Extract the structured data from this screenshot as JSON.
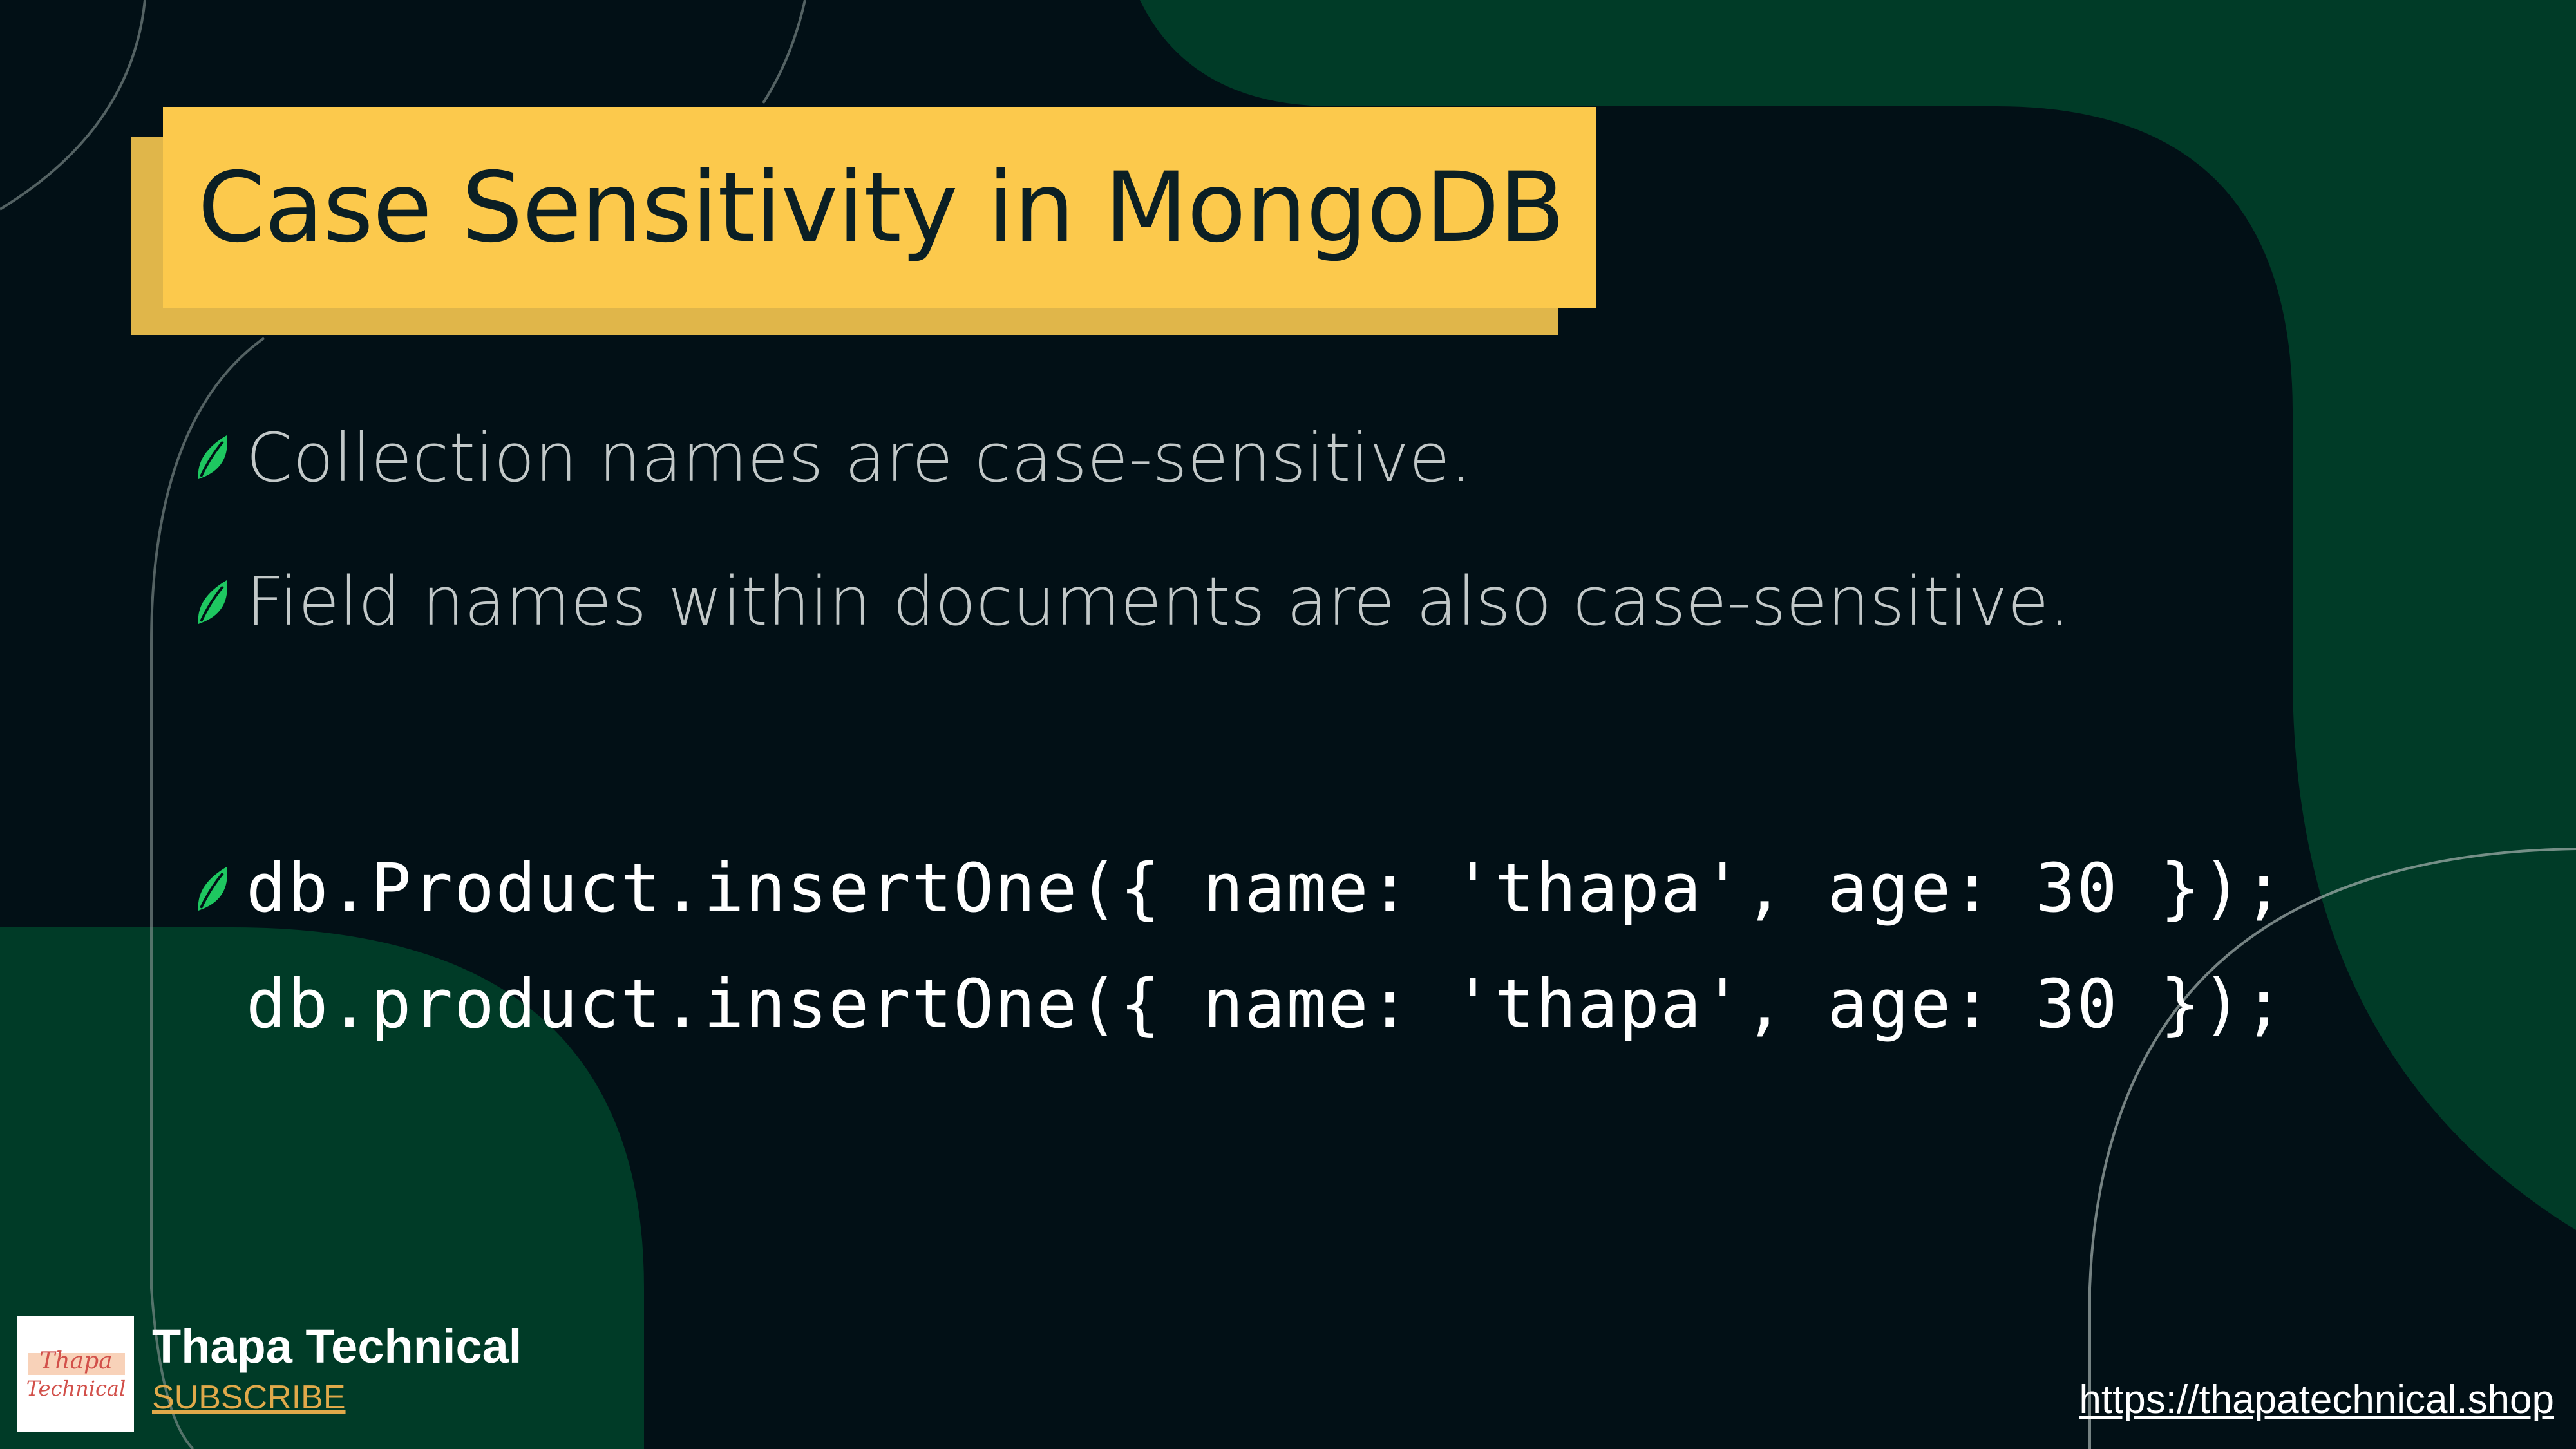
{
  "title": "Case Sensitivity in MongoDB",
  "bullets": [
    "Collection names are case-sensitive.",
    "Field names within documents are also case-sensitive."
  ],
  "code_lines": [
    "db.Product.insertOne({ name: 'thapa', age: 30 });",
    "db.product.insertOne({ name: 'thapa', age: 30 });"
  ],
  "footer": {
    "logo_text": [
      "Thapa",
      "Technical"
    ],
    "brand_name": "Thapa Technical",
    "subscribe_label": "SUBSCRIBE",
    "url": "https://thapatechnical.shop"
  },
  "colors": {
    "background": "#021016",
    "green_blob": "#003b27",
    "title_bg": "#fcc94c",
    "bullet_icon": "#1ec760",
    "subscribe": "#e0a94a"
  },
  "icons": {
    "bullet": "leaf-icon"
  }
}
